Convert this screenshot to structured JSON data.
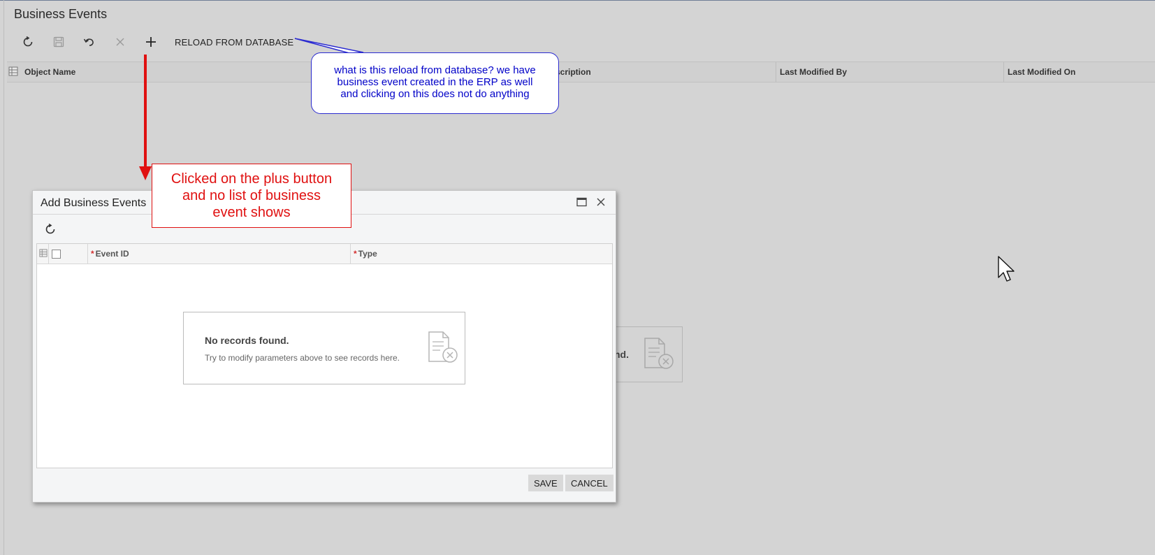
{
  "page": {
    "title": "Business Events"
  },
  "toolbar": {
    "refresh_icon": "refresh-icon",
    "save_icon": "save-icon",
    "undo_icon": "undo-icon",
    "delete_icon": "close-icon",
    "add_icon": "plus-icon",
    "reload_label": "RELOAD FROM DATABASE"
  },
  "grid": {
    "columns": [
      "Object Name",
      "scription",
      "Last Modified By",
      "Last Modified On"
    ],
    "empty_text": "nd."
  },
  "dialog": {
    "title": "Add Business Events",
    "columns": {
      "event_id": "Event ID",
      "type": "Type"
    },
    "empty": {
      "title": "No records found.",
      "subtitle": "Try to modify parameters above to see records here."
    },
    "buttons": {
      "save": "SAVE",
      "cancel": "CANCEL"
    }
  },
  "annotations": {
    "bubble_lines": [
      "what is this reload from database? we have",
      "business event created in the ERP as well",
      "and clicking on this does not do anything"
    ],
    "callout_lines": [
      "Clicked on the plus button",
      "and no list of business",
      "event shows"
    ],
    "bubble_color": "#0000c8",
    "callout_color": "#e01010"
  }
}
